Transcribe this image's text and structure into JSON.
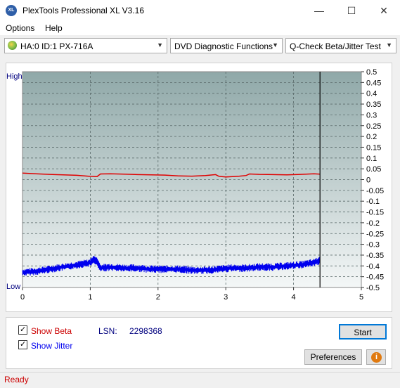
{
  "window": {
    "title": "PlexTools Professional XL V3.16",
    "app_icon_text": "XL",
    "minimize": "—",
    "maximize": "☐",
    "close": "✕"
  },
  "menu": {
    "options": "Options",
    "help": "Help"
  },
  "toolbar": {
    "drive": "HA:0 ID:1  PX-716A",
    "function": "DVD Diagnostic Functions",
    "test": "Q-Check Beta/Jitter Test"
  },
  "chart_data": {
    "type": "line",
    "left_axis_labels": {
      "top": "High",
      "bottom": "Low"
    },
    "x_ticks": [
      0,
      1,
      2,
      3,
      4,
      5
    ],
    "xlim": [
      0,
      5
    ],
    "y_ticks": [
      "0.5",
      "0.45",
      "0.4",
      "0.35",
      "0.3",
      "0.25",
      "0.2",
      "0.15",
      "0.1",
      "0.05",
      "0",
      "-0.05",
      "-0.1",
      "-0.15",
      "-0.2",
      "-0.25",
      "-0.3",
      "-0.35",
      "-0.4",
      "-0.45",
      "-0.5"
    ],
    "ylim": [
      -0.5,
      0.5
    ],
    "grid": true,
    "end_marker_x": 4.39,
    "series": [
      {
        "color": "#e00000",
        "kind": "beta",
        "x": [
          0,
          0.2,
          0.4,
          0.6,
          0.8,
          1.0,
          1.1,
          1.15,
          1.3,
          1.5,
          1.7,
          1.9,
          2.1,
          2.3,
          2.5,
          2.7,
          2.85,
          2.9,
          3.0,
          3.1,
          3.2,
          3.3,
          3.35,
          3.5,
          3.7,
          3.9,
          4.1,
          4.3,
          4.39
        ],
        "y": [
          0.03,
          0.027,
          0.024,
          0.022,
          0.02,
          0.015,
          0.014,
          0.026,
          0.027,
          0.025,
          0.023,
          0.022,
          0.021,
          0.017,
          0.016,
          0.019,
          0.023,
          0.015,
          0.012,
          0.014,
          0.016,
          0.019,
          0.026,
          0.024,
          0.023,
          0.022,
          0.024,
          0.027,
          0.025
        ]
      },
      {
        "color": "#0000ee",
        "kind": "jitter",
        "x": [
          0,
          0.2,
          0.4,
          0.6,
          0.8,
          1.0,
          1.05,
          1.1,
          1.15,
          1.3,
          1.5,
          1.7,
          1.9,
          2.1,
          2.3,
          2.5,
          2.7,
          2.9,
          3.1,
          3.3,
          3.5,
          3.7,
          3.9,
          4.1,
          4.3,
          4.39
        ],
        "y": [
          -0.43,
          -0.425,
          -0.415,
          -0.405,
          -0.395,
          -0.385,
          -0.37,
          -0.38,
          -0.41,
          -0.405,
          -0.41,
          -0.41,
          -0.415,
          -0.415,
          -0.415,
          -0.42,
          -0.42,
          -0.415,
          -0.41,
          -0.41,
          -0.405,
          -0.405,
          -0.4,
          -0.395,
          -0.385,
          -0.375
        ]
      }
    ]
  },
  "controls": {
    "show_beta": "Show Beta",
    "show_jitter": "Show Jitter",
    "lsn_label": "LSN:",
    "lsn_value": "2298368",
    "start": "Start",
    "preferences": "Preferences",
    "info": "i"
  },
  "status": {
    "text": "Ready"
  },
  "colors": {
    "beta": "#e00000",
    "jitter": "#0000ee",
    "accent_text": "#00007f",
    "status": "#cc0000"
  }
}
